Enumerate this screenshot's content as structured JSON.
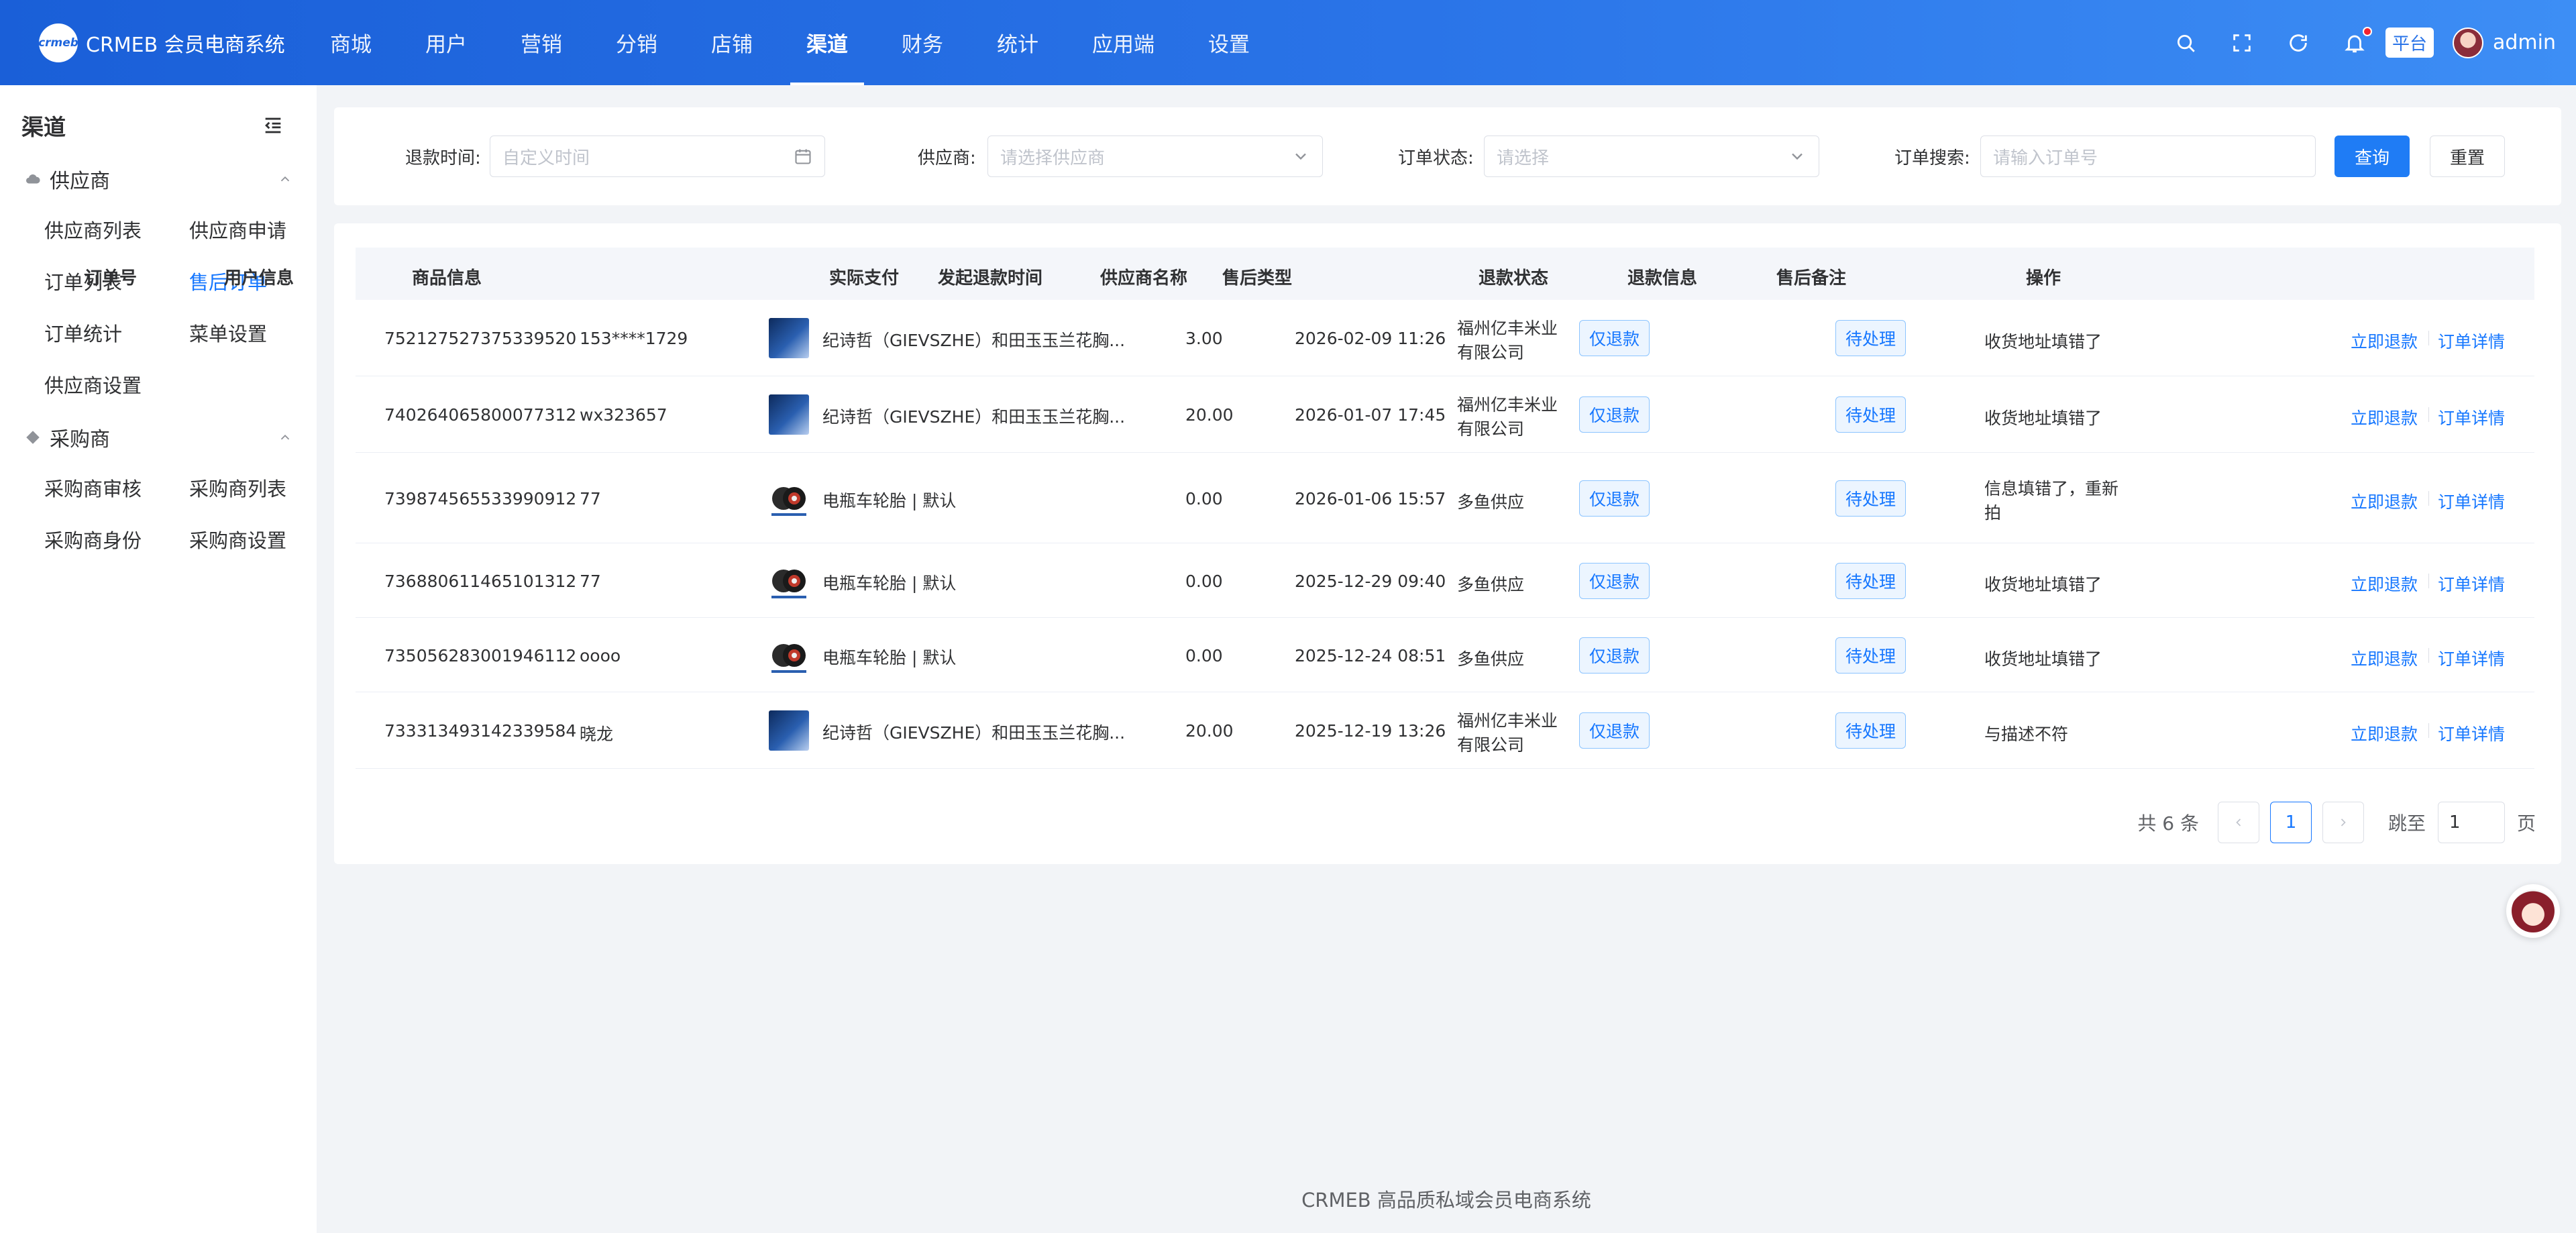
{
  "brand": {
    "logo_text": "crmeb",
    "name": "CRMEB 会员电商系统"
  },
  "topnav": [
    {
      "label": "商城"
    },
    {
      "label": "用户"
    },
    {
      "label": "营销"
    },
    {
      "label": "分销"
    },
    {
      "label": "店铺"
    },
    {
      "label": "渠道",
      "active": true
    },
    {
      "label": "财务"
    },
    {
      "label": "统计"
    },
    {
      "label": "应用端"
    },
    {
      "label": "设置"
    }
  ],
  "topright": {
    "platform_tag": "平台",
    "username": "admin"
  },
  "sidebar": {
    "title": "渠道",
    "groups": [
      {
        "label": "供应商",
        "icon": "cloud-icon",
        "items": [
          {
            "label": "供应商列表"
          },
          {
            "label": "供应商申请"
          },
          {
            "label": "订单列表"
          },
          {
            "label": "售后订单",
            "active": true
          },
          {
            "label": "订单统计"
          },
          {
            "label": "菜单设置"
          },
          {
            "label": "供应商设置"
          }
        ]
      },
      {
        "label": "采购商",
        "icon": "diamond-icon",
        "items": [
          {
            "label": "采购商审核"
          },
          {
            "label": "采购商列表"
          },
          {
            "label": "采购商身份"
          },
          {
            "label": "采购商设置"
          }
        ]
      }
    ]
  },
  "filters": {
    "refund_time": {
      "label": "退款时间:",
      "placeholder": "自定义时间"
    },
    "supplier": {
      "label": "供应商:",
      "placeholder": "请选择供应商"
    },
    "order_status": {
      "label": "订单状态:",
      "placeholder": "请选择"
    },
    "order_search": {
      "label": "订单搜索:",
      "placeholder": "请输入订单号"
    },
    "query_label": "查询",
    "reset_label": "重置"
  },
  "table": {
    "columns": [
      "订单号",
      "用户信息",
      "商品信息",
      "实际支付",
      "发起退款时间",
      "供应商名称",
      "售后类型",
      "退款状态",
      "退款信息",
      "售后备注",
      "操作"
    ],
    "rows": [
      {
        "order_no": "752127527375339520",
        "user": "153****1729",
        "product": "纪诗哲（GIEVSZHE）和田玉玉兰花胸...",
        "img": "jewel",
        "paid": "3.00",
        "time": "2026-02-09 11:26",
        "supplier_l1": "福州亿丰米业",
        "supplier_l2": "有限公司",
        "type": "仅退款",
        "status": "待处理",
        "info_l1": "收货地址填错了",
        "info_l2": "",
        "remark": ""
      },
      {
        "order_no": "740264065800077312",
        "user": "wx323657",
        "product": "纪诗哲（GIEVSZHE）和田玉玉兰花胸...",
        "img": "jewel",
        "paid": "20.00",
        "time": "2026-01-07 17:45",
        "supplier_l1": "福州亿丰米业",
        "supplier_l2": "有限公司",
        "type": "仅退款",
        "status": "待处理",
        "info_l1": "收货地址填错了",
        "info_l2": "",
        "remark": ""
      },
      {
        "order_no": "739874565533990912",
        "user": "77",
        "product": "电瓶车轮胎 | 默认",
        "img": "tire",
        "paid": "0.00",
        "time": "2026-01-06 15:57",
        "supplier_l1": "多鱼供应",
        "supplier_l2": "",
        "type": "仅退款",
        "status": "待处理",
        "info_l1": "信息填错了，重新",
        "info_l2": "拍",
        "remark": ""
      },
      {
        "order_no": "736880611465101312",
        "user": "77",
        "product": "电瓶车轮胎 | 默认",
        "img": "tire",
        "paid": "0.00",
        "time": "2025-12-29 09:40",
        "supplier_l1": "多鱼供应",
        "supplier_l2": "",
        "type": "仅退款",
        "status": "待处理",
        "info_l1": "收货地址填错了",
        "info_l2": "",
        "remark": ""
      },
      {
        "order_no": "735056283001946112",
        "user": "oooo",
        "product": "电瓶车轮胎 | 默认",
        "img": "tire",
        "paid": "0.00",
        "time": "2025-12-24 08:51",
        "supplier_l1": "多鱼供应",
        "supplier_l2": "",
        "type": "仅退款",
        "status": "待处理",
        "info_l1": "收货地址填错了",
        "info_l2": "",
        "remark": ""
      },
      {
        "order_no": "733313493142339584",
        "user": "晓龙",
        "product": "纪诗哲（GIEVSZHE）和田玉玉兰花胸...",
        "img": "jewel",
        "paid": "20.00",
        "time": "2025-12-19 13:26",
        "supplier_l1": "福州亿丰米业",
        "supplier_l2": "有限公司",
        "type": "仅退款",
        "status": "待处理",
        "info_l1": "与描述不符",
        "info_l2": "",
        "remark": ""
      }
    ],
    "action_refund": "立即退款",
    "action_detail": "订单详情"
  },
  "pagination": {
    "total_text": "共 6 条",
    "current_page": "1",
    "jump_label": "跳至",
    "jump_value": "1",
    "page_suffix": "页"
  },
  "footer": "CRMEB 高品质私域会员电商系统",
  "colors": {
    "primary": "#1677ff",
    "topbar_start": "#1a5fd8",
    "topbar_end": "#3d8ef5"
  }
}
